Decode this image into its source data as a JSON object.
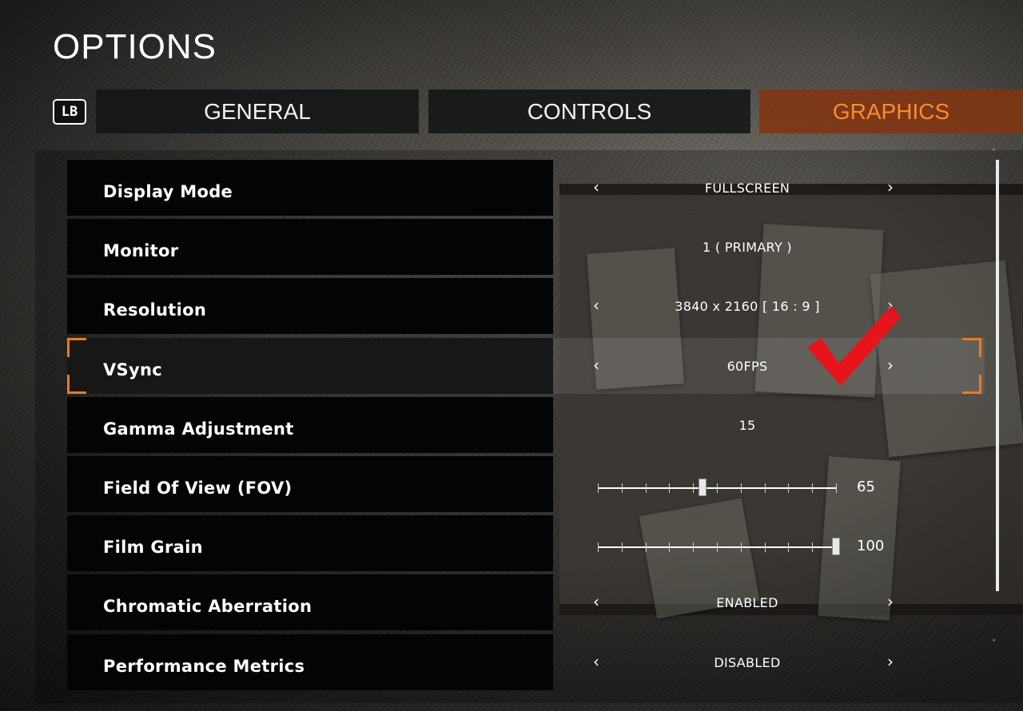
{
  "screen": {
    "title": "OPTIONS"
  },
  "tabs": {
    "lb_label": "LB",
    "items": [
      {
        "label": "GENERAL",
        "active": false
      },
      {
        "label": "CONTROLS",
        "active": false
      },
      {
        "label": "GRAPHICS",
        "active": true
      }
    ]
  },
  "colors": {
    "accent": "#f07a1c",
    "active_tab_text": "#ff8a30",
    "annotation": "#e8141b"
  },
  "options": [
    {
      "label": "Display Mode",
      "type": "selector",
      "value": "FULLSCREEN",
      "arrows": true
    },
    {
      "label": "Monitor",
      "type": "selector",
      "value": "1 ( PRIMARY )",
      "arrows": false
    },
    {
      "label": "Resolution",
      "type": "selector",
      "value": "3840 x 2160 [ 16 :  9 ]",
      "arrows": true
    },
    {
      "label": "VSync",
      "type": "selector",
      "value": "60FPS",
      "arrows": true,
      "selected": true
    },
    {
      "label": "Gamma Adjustment",
      "type": "value",
      "value": "15"
    },
    {
      "label": "Field Of View (FOV)",
      "type": "slider",
      "value": "65",
      "fill": 0.44
    },
    {
      "label": "Film Grain",
      "type": "slider",
      "value": "100",
      "fill": 1.0
    },
    {
      "label": "Chromatic Aberration",
      "type": "selector",
      "value": "ENABLED",
      "arrows": true
    },
    {
      "label": "Performance Metrics",
      "type": "selector",
      "value": "DISABLED",
      "arrows": true
    }
  ],
  "icons": {
    "left_arrow": "chevron-left-icon",
    "right_arrow": "chevron-right-icon",
    "annotation": "red-checkmark-icon"
  }
}
